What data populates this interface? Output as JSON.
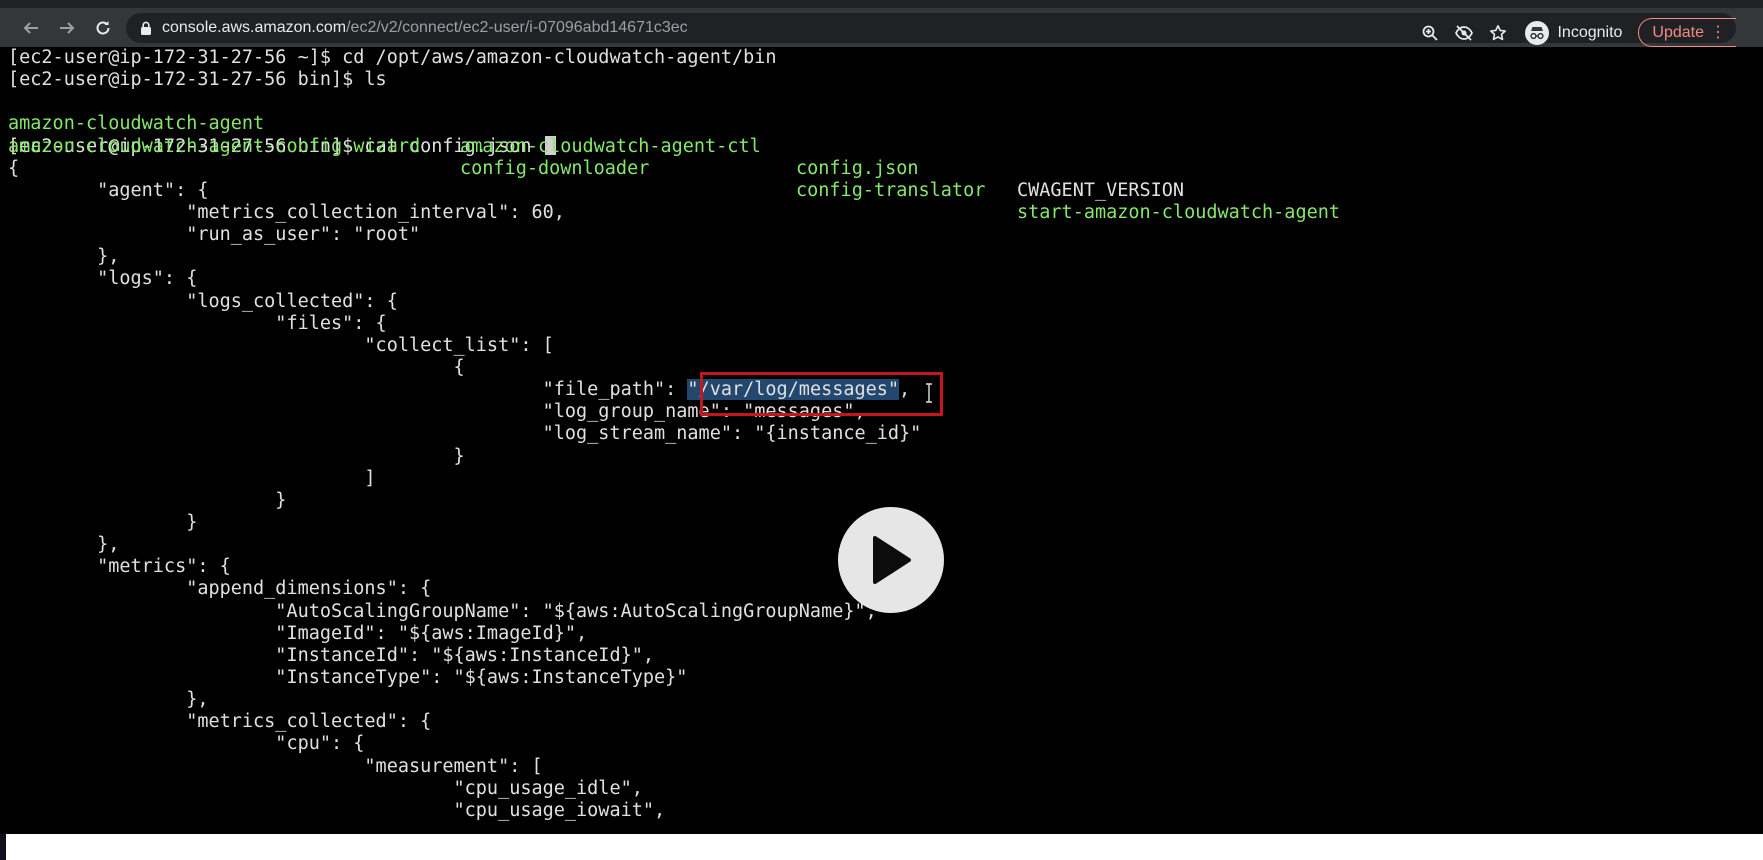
{
  "browser": {
    "url_domain": "console.aws.amazon.com",
    "url_path": "/ec2/v2/connect/ec2-user/i-07096abd14671c3ec",
    "incognito_label": "Incognito",
    "update_label": "Update",
    "icons": [
      "back-arrow-icon",
      "forward-arrow-icon",
      "reload-icon",
      "lock-icon",
      "zoom-icon",
      "eye-off-icon",
      "star-icon",
      "incognito-icon",
      "more-vert-icon"
    ],
    "colors": {
      "update": "#f28b82",
      "toolbar": "#35363a"
    }
  },
  "terminal": {
    "line_cd": "[ec2-user@ip-172-31-27-56 ~]$ cd /opt/aws/amazon-cloudwatch-agent/bin",
    "line_ls": "[ec2-user@ip-172-31-27-56 bin]$ ls",
    "ls_row1": [
      "amazon-cloudwatch-agent",
      "amazon-cloudwatch-agent-ctl",
      "config.json",
      "CWAGENT_VERSION"
    ],
    "ls_row2": [
      "amazon-cloudwatch-agent-config-wizard",
      "config-downloader",
      "config-translator",
      "start-amazon-cloudwatch-agent"
    ],
    "line_cat": "[ec2-user@ip-172-31-27-56 bin]$ cat config.json ",
    "lines": [
      "{",
      "        \"agent\": {",
      "                \"metrics_collection_interval\": 60,",
      "                \"run_as_user\": \"root\"",
      "        },",
      "        \"logs\": {",
      "                \"logs_collected\": {",
      "                        \"files\": {",
      "                                \"collect_list\": [",
      "                                        {"
    ],
    "file_path_prefix": "                                                \"file_path\": ",
    "file_path_value": "\"/var/log/messages\"",
    "file_path_suffix": ",",
    "lines_after": [
      "                                                \"log_group_name\": \"messages\",",
      "                                                \"log_stream_name\": \"{instance_id}\"",
      "                                        }",
      "                                ]",
      "                        }",
      "                }",
      "        },",
      "        \"metrics\": {",
      "                \"append_dimensions\": {",
      "                        \"AutoScalingGroupName\": \"${aws:AutoScalingGroupName}\",",
      "                        \"ImageId\": \"${aws:ImageId}\",",
      "                        \"InstanceId\": \"${aws:InstanceId}\",",
      "                        \"InstanceType\": \"${aws:InstanceType}\"",
      "                },",
      "                \"metrics_collected\": {",
      "                        \"cpu\": {",
      "                                \"measurement\": [",
      "                                        \"cpu_usage_idle\",",
      "                                        \"cpu_usage_iowait\","
    ],
    "colors": {
      "ls_green": "#86e86a",
      "selection": "#23486f",
      "annotation_box": "#c4171d"
    }
  },
  "overlay": {
    "play_icon": "play-icon"
  }
}
